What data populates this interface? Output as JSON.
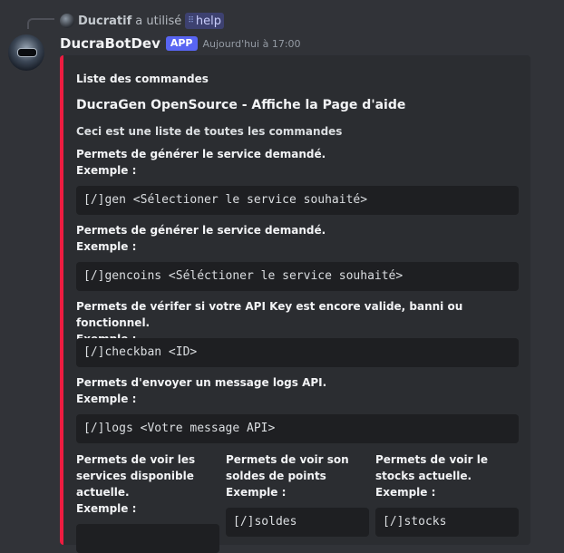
{
  "reply": {
    "username": "Ducratif",
    "action": "a utilisé",
    "command": "help"
  },
  "message": {
    "username": "DucraBotDev",
    "badge": "APP",
    "timestamp": "Aujourd'hui à 17:00"
  },
  "embed": {
    "accent_color": "#ed1c40",
    "author": "Liste des commandes",
    "title": "DucraGen OpenSource - Affiche la Page d'aide",
    "description": "Ceci est une liste de toutes les commandes",
    "fields": [
      {
        "name": "Permets de générer le service demandé.",
        "example_label": "Exemple :",
        "code": "[/]gen <Sélectioner le service souhaité>"
      },
      {
        "name": "Permets de générer le service demandé.",
        "example_label": "Exemple :",
        "code": "[/]gencoins <Séléctioner le service souhaité>"
      },
      {
        "name": "Permets de vérifer si votre API Key est encore valide, banni ou fonctionnel.",
        "example_label": "Exemple :",
        "code": "[/]checkban <ID>"
      },
      {
        "name": "Permets d'envoyer un message logs API.",
        "example_label": "Exemple :",
        "code": "[/]logs <Votre message API>"
      }
    ],
    "inline_fields": [
      {
        "name": "Permets de voir les services disponible actuelle.",
        "example_label": "Exemple :",
        "code": ""
      },
      {
        "name": "Permets de voir son soldes de points",
        "example_label": "Exemple :",
        "code": "[/]soldes"
      },
      {
        "name": "Permets de voir le stocks actuelle.",
        "example_label": "Exemple :",
        "code": "[/]stocks"
      }
    ]
  }
}
